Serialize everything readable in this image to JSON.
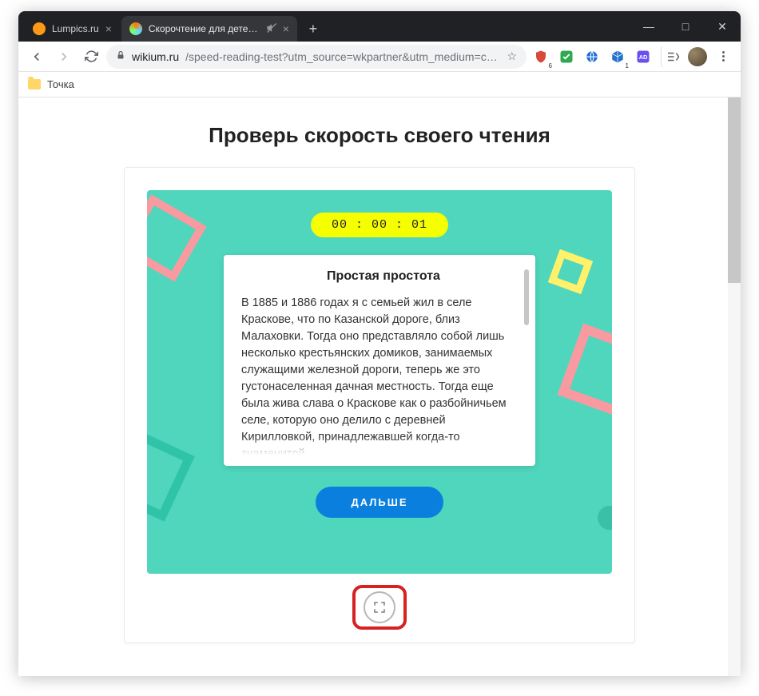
{
  "window_controls": {
    "min": "—",
    "max": "□",
    "close": "✕"
  },
  "tabs": [
    {
      "title": "Lumpics.ru",
      "active": false
    },
    {
      "title": "Скорочтение для детей и в…",
      "active": true,
      "muted": true
    }
  ],
  "newtab": "+",
  "nav": {
    "back": "←",
    "forward": "→",
    "reload": "↻"
  },
  "omnibox": {
    "domain": "wikium.ru",
    "path": "/speed-reading-test?utm_source=wkpartner&utm_medium=cpa&…"
  },
  "bookmarks": {
    "item1": "Точка"
  },
  "exticons": {
    "shield_badge": "6",
    "cube_badge": "1"
  },
  "page": {
    "title": "Проверь скорость своего чтения",
    "timer": "00 : 00 : 01",
    "reading_title": "Простая простота",
    "reading_body": "В 1885 и 1886 годах я с семьей жил в селе Краскове, что по Казанской дороге, близ Малаховки. Тогда оно представляло собой лишь несколько крестьянских домиков, занимаемых служащими железной дороги, теперь же это густонаселенная дачная местность. Тогда еще была жива слава о Краскове как о разбойничьем селе, которую оно делило с деревней Кирилловкой, принадлежавшей когда-то знаменитой",
    "next_label": "ДАЛЬШЕ"
  }
}
